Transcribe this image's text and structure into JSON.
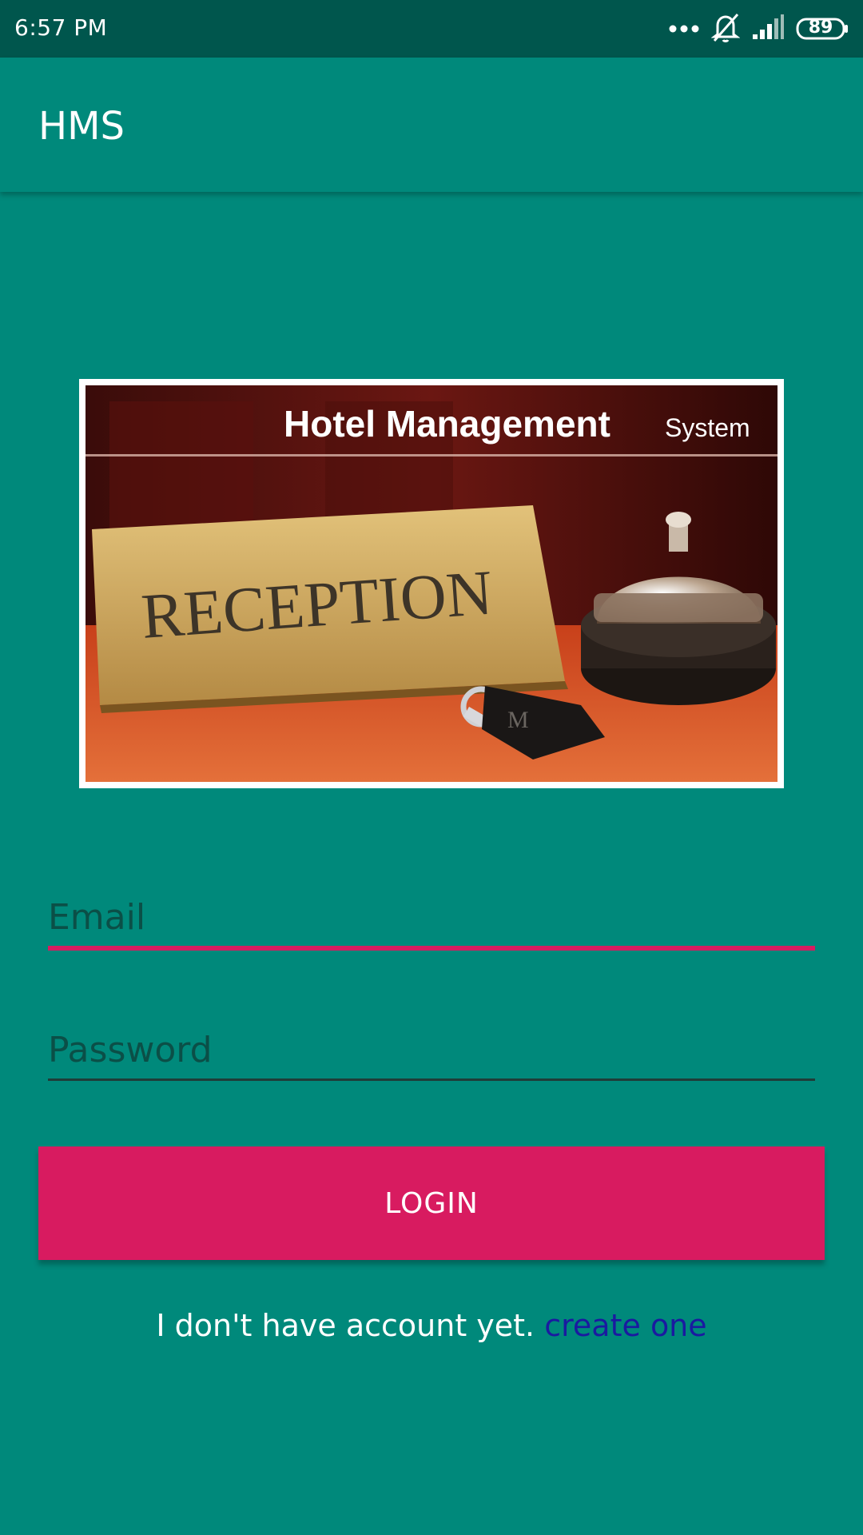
{
  "status_bar": {
    "time": "6:57 PM",
    "battery": "89",
    "icons": [
      "more-dots-icon",
      "bell-off-icon",
      "signal-icon",
      "battery-icon"
    ]
  },
  "app_bar": {
    "title": "HMS"
  },
  "hero": {
    "title_main": "Hotel Management",
    "title_sub": "System",
    "sign_text": "RECEPTION"
  },
  "form": {
    "email_placeholder": "Email",
    "password_placeholder": "Password",
    "login_label": "LOGIN"
  },
  "signup": {
    "prompt": "I don't have account yet.",
    "link": "create one"
  },
  "colors": {
    "primary": "#00897b",
    "status_bar": "#00564d",
    "accent": "#d81b60",
    "link": "#1a1aa0"
  }
}
